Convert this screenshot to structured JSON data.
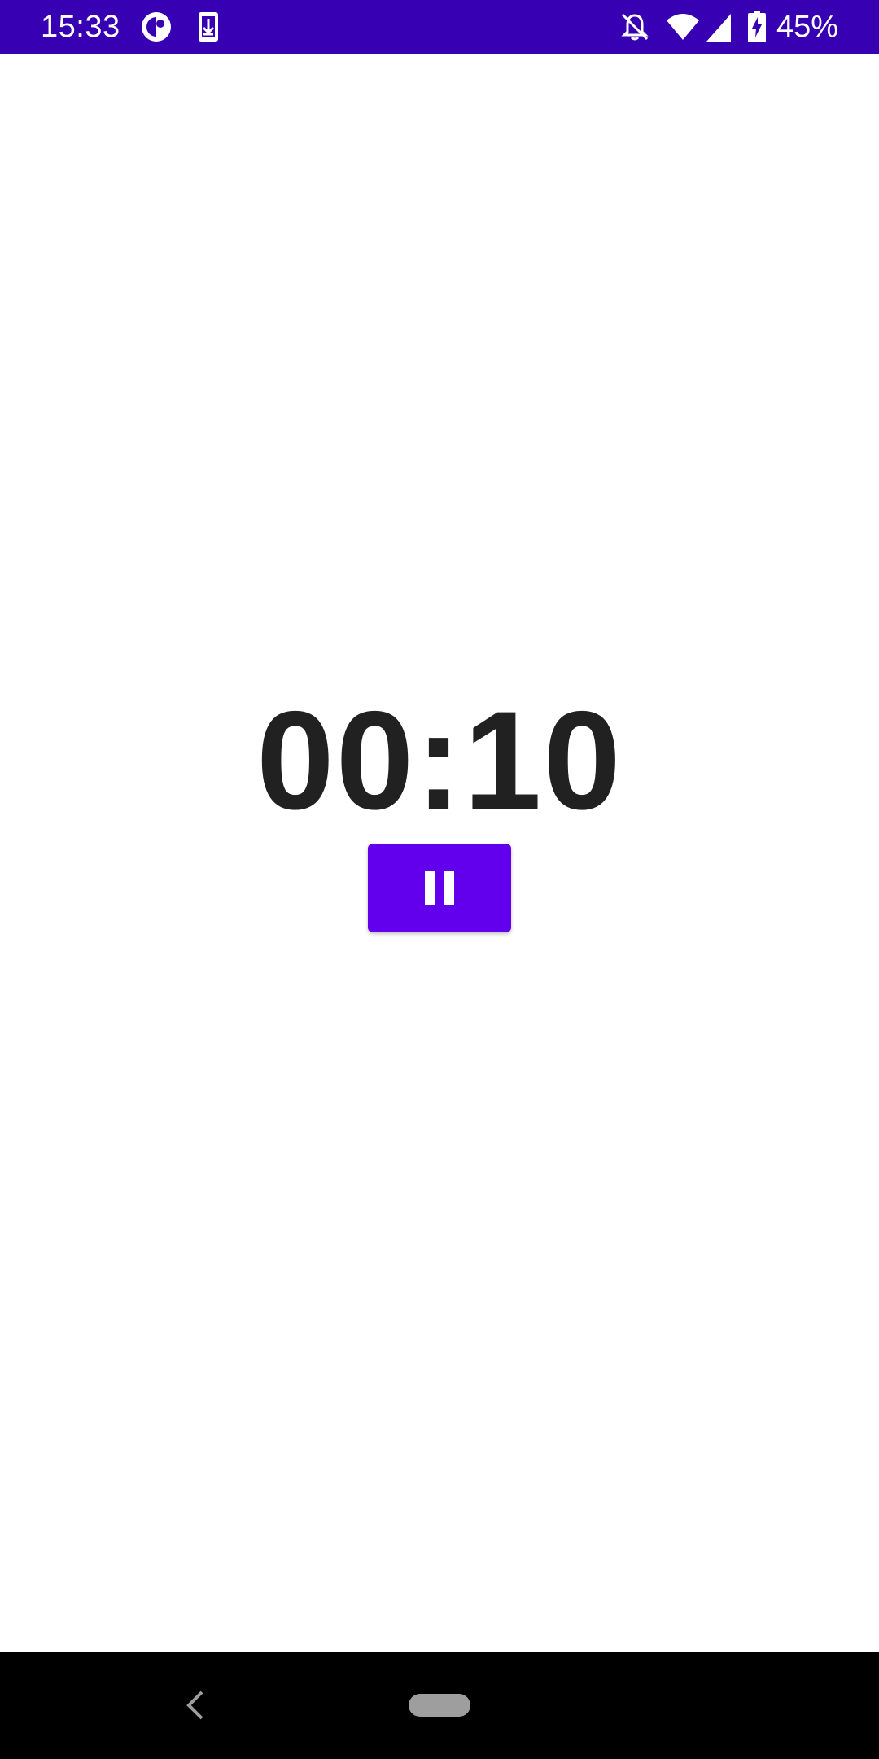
{
  "status_bar": {
    "time": "15:33",
    "battery_percent": "45%",
    "background_color": "#3700b3",
    "icons_left": [
      "circle-app-icon",
      "download-icon"
    ],
    "icons_right": [
      "notifications-off-icon",
      "wifi-icon",
      "signal-icon",
      "battery-charging-icon"
    ]
  },
  "timer": {
    "display": "00:10"
  },
  "controls": {
    "pause_button_icon": "pause-icon",
    "pause_button_color": "#6200ee"
  },
  "navigation_bar": {
    "back_icon": "back-icon",
    "home_icon": "home-pill"
  }
}
